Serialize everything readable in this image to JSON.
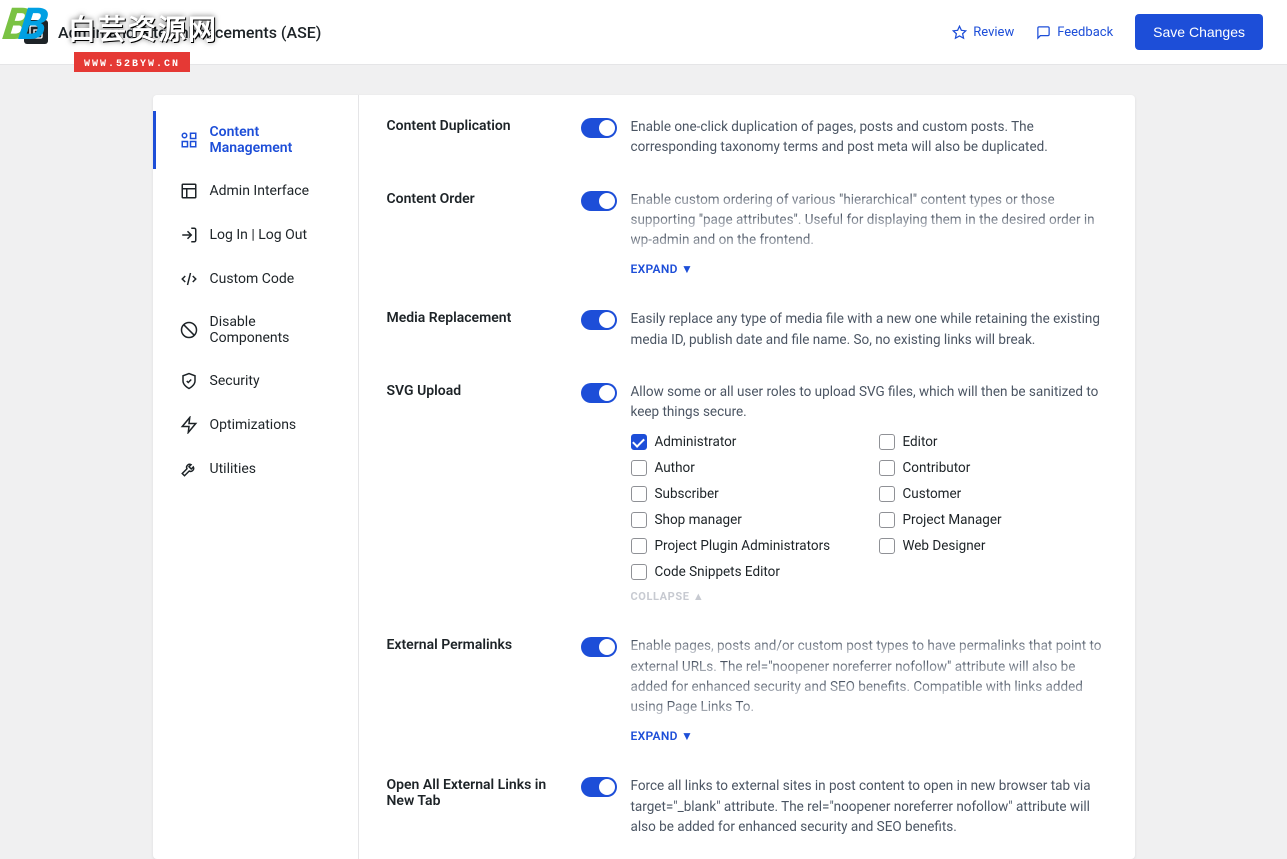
{
  "header": {
    "title": "Admin and Site Enhancements (ASE)",
    "review": "Review",
    "feedback": "Feedback",
    "save": "Save Changes"
  },
  "watermark": {
    "text": "白芸资源网",
    "url": "WWW.52BYW.CN"
  },
  "sidebar": {
    "items": [
      {
        "label": "Content Management",
        "active": true
      },
      {
        "label": "Admin Interface"
      },
      {
        "label": "Log In | Log Out"
      },
      {
        "label": "Custom Code"
      },
      {
        "label": "Disable Components"
      },
      {
        "label": "Security"
      },
      {
        "label": "Optimizations"
      },
      {
        "label": "Utilities"
      }
    ]
  },
  "settings": {
    "content_duplication": {
      "title": "Content Duplication",
      "desc": "Enable one-click duplication of pages, posts and custom posts. The corresponding taxonomy terms and post meta will also be duplicated."
    },
    "content_order": {
      "title": "Content Order",
      "desc": "Enable custom ordering of various \"hierarchical\" content types or those supporting \"page attributes\". Useful for displaying them in the desired order in wp-admin and on the frontend.",
      "expand": "EXPAND ▼"
    },
    "media_replacement": {
      "title": "Media Replacement",
      "desc": "Easily replace any type of media file with a new one while retaining the existing media ID, publish date and file name. So, no existing links will break."
    },
    "svg_upload": {
      "title": "SVG Upload",
      "desc": "Allow some or all user roles to upload SVG files, which will then be sanitized to keep things secure.",
      "roles": [
        {
          "label": "Administrator",
          "checked": true
        },
        {
          "label": "Editor",
          "checked": false
        },
        {
          "label": "Author",
          "checked": false
        },
        {
          "label": "Contributor",
          "checked": false
        },
        {
          "label": "Subscriber",
          "checked": false
        },
        {
          "label": "Customer",
          "checked": false
        },
        {
          "label": "Shop manager",
          "checked": false
        },
        {
          "label": "Project Manager",
          "checked": false
        },
        {
          "label": "Project Plugin Administrators",
          "checked": false
        },
        {
          "label": "Web Designer",
          "checked": false
        },
        {
          "label": "Code Snippets Editor",
          "checked": false
        }
      ],
      "collapse": "COLLAPSE ▲"
    },
    "external_permalinks": {
      "title": "External Permalinks",
      "desc": "Enable pages, posts and/or custom post types to have permalinks that point to external URLs. The rel=\"noopener noreferrer nofollow\" attribute will also be added for enhanced security and SEO benefits. Compatible with links added using ",
      "link": "Page Links To",
      "suffix": ".",
      "expand": "EXPAND ▼"
    },
    "open_external": {
      "title": "Open All External Links in New Tab",
      "desc": "Force all links to external sites in post content to open in new browser tab via target=\"_blank\" attribute. The rel=\"noopener noreferrer nofollow\" attribute will also be added for enhanced security and SEO benefits."
    }
  }
}
